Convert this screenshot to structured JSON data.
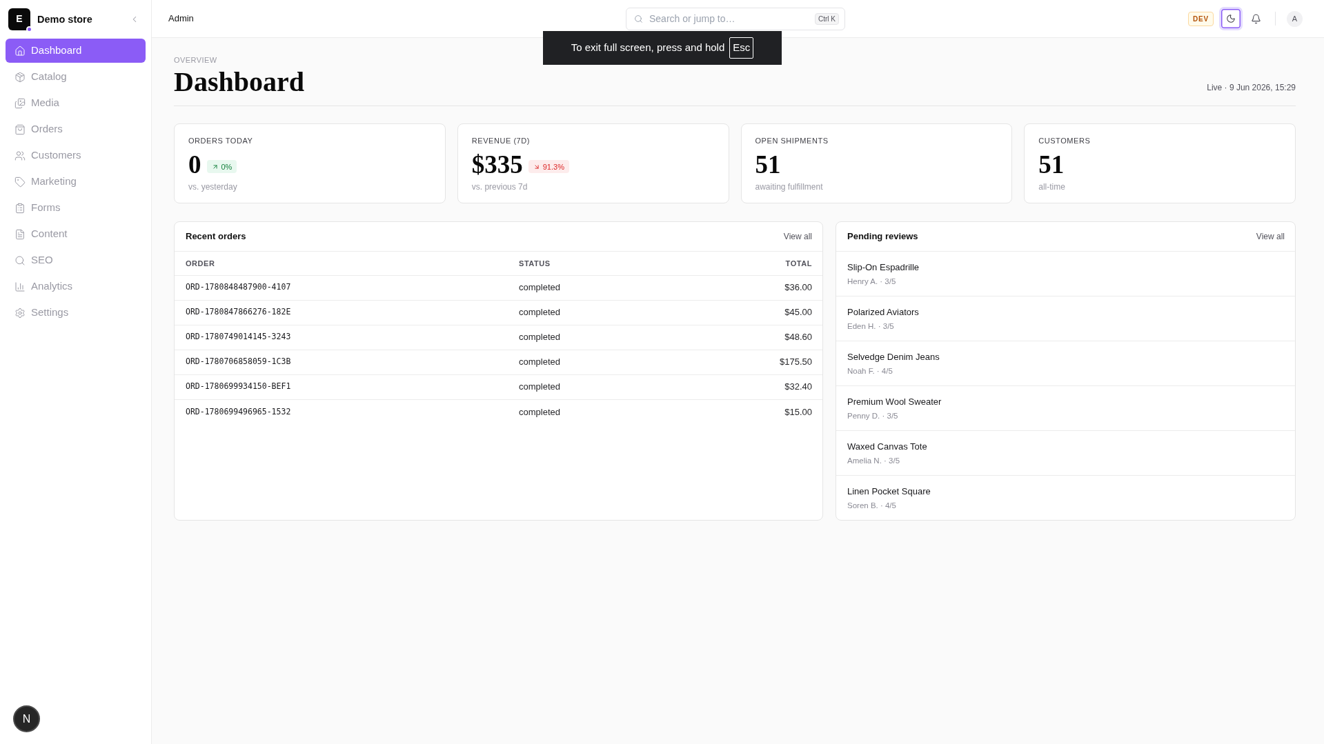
{
  "sidebar": {
    "brand": {
      "initial": "E",
      "name": "Demo store"
    },
    "items": [
      {
        "label": "Dashboard",
        "selected": true
      },
      {
        "label": "Catalog",
        "selected": false
      },
      {
        "label": "Media",
        "selected": false
      },
      {
        "label": "Orders",
        "selected": false
      },
      {
        "label": "Customers",
        "selected": false
      },
      {
        "label": "Marketing",
        "selected": false
      },
      {
        "label": "Forms",
        "selected": false
      },
      {
        "label": "Content",
        "selected": false
      },
      {
        "label": "SEO",
        "selected": false
      },
      {
        "label": "Analytics",
        "selected": false
      },
      {
        "label": "Settings",
        "selected": false
      }
    ],
    "dev_indicator": "N"
  },
  "topbar": {
    "title": "Admin",
    "search": {
      "placeholder": "Search or jump to…",
      "shortcut": "Ctrl K"
    },
    "env_badge": "DEV",
    "avatar": "A"
  },
  "fullscreen_notice": {
    "text": "To exit full screen, press and hold",
    "key": "Esc"
  },
  "header": {
    "eyebrow": "OVERVIEW",
    "title": "Dashboard",
    "timestamp": "Live · 9 Jun 2026, 15:29"
  },
  "stats": [
    {
      "label": "ORDERS TODAY",
      "value": "0",
      "delta": {
        "text": "0%",
        "kind": "increase"
      },
      "caption": "vs. yesterday"
    },
    {
      "label": "REVENUE (7D)",
      "value": "$335",
      "delta": {
        "text": "91.3%",
        "kind": "decrease"
      },
      "caption": "vs. previous 7d"
    },
    {
      "label": "OPEN SHIPMENTS",
      "value": "51",
      "caption": "awaiting fulfillment"
    },
    {
      "label": "CUSTOMERS",
      "value": "51",
      "caption": "all-time"
    }
  ],
  "recent_orders": {
    "title": "Recent orders",
    "link": "View all",
    "columns": [
      "ORDER",
      "STATUS",
      "TOTAL"
    ],
    "rows": [
      {
        "order": "ORD-1780848487900-4107",
        "status": "completed",
        "total": "$36.00"
      },
      {
        "order": "ORD-1780847866276-182E",
        "status": "completed",
        "total": "$45.00"
      },
      {
        "order": "ORD-1780749014145-3243",
        "status": "completed",
        "total": "$48.60"
      },
      {
        "order": "ORD-1780706858059-1C3B",
        "status": "completed",
        "total": "$175.50"
      },
      {
        "order": "ORD-1780699934150-BEF1",
        "status": "completed",
        "total": "$32.40"
      },
      {
        "order": "ORD-1780699496965-1532",
        "status": "completed",
        "total": "$15.00"
      }
    ]
  },
  "pending_reviews": {
    "title": "Pending reviews",
    "link": "View all",
    "items": [
      {
        "product": "Slip-On Espadrille",
        "meta": "Henry A. · 3/5"
      },
      {
        "product": "Polarized Aviators",
        "meta": "Eden H. · 3/5"
      },
      {
        "product": "Selvedge Denim Jeans",
        "meta": "Noah F. · 4/5"
      },
      {
        "product": "Premium Wool Sweater",
        "meta": "Penny D. · 3/5"
      },
      {
        "product": "Waxed Canvas Tote",
        "meta": "Amelia N. · 3/5"
      },
      {
        "product": "Linen Pocket Square",
        "meta": "Soren B. · 4/5"
      }
    ]
  }
}
